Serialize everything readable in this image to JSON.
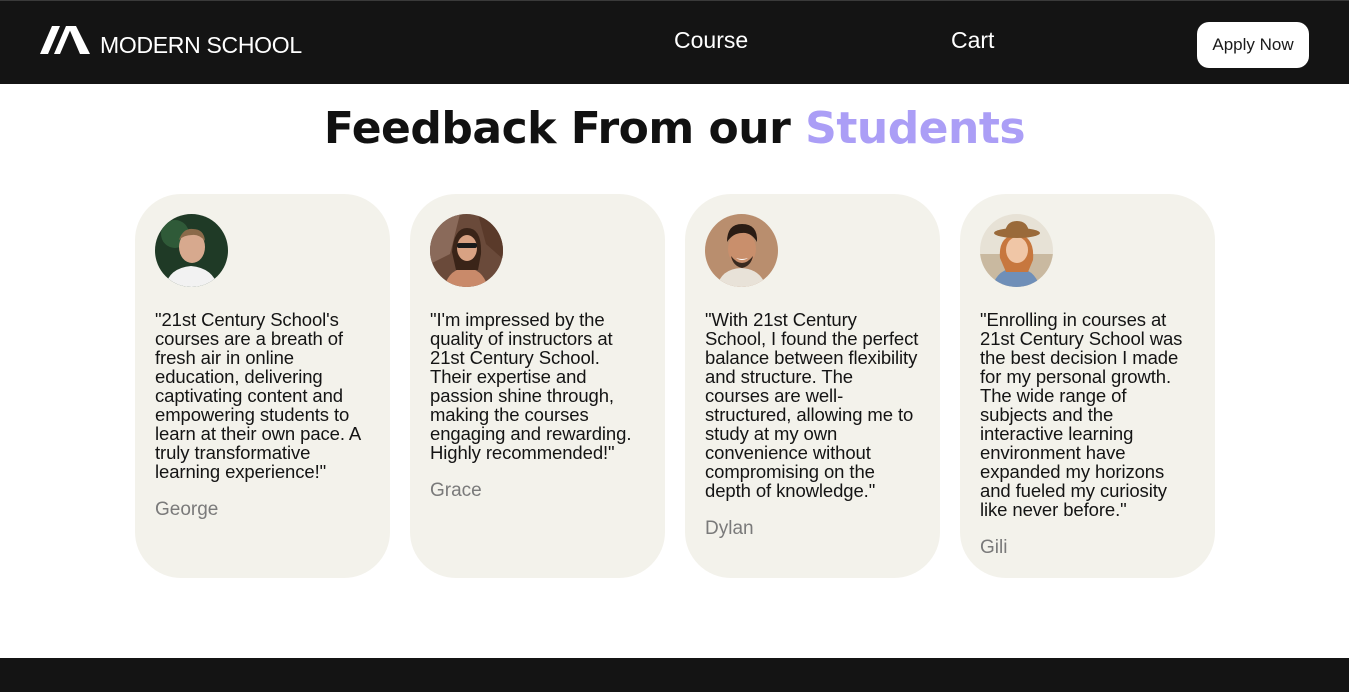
{
  "header": {
    "brand": "MODERN SCHOOL",
    "nav": [
      {
        "label": "Course"
      },
      {
        "label": "Cart"
      }
    ],
    "cta_label": "Apply Now"
  },
  "section": {
    "title_main": "Feedback From our",
    "title_accent": "Students",
    "accent_color": "#ab9ef6"
  },
  "testimonials": [
    {
      "quote": "\"21st Century School's courses are a breath of fresh air in online education, delivering captivating content and empowering students to learn at their own pace. A truly transformative learning experience!\"",
      "author": "George",
      "avatar": "avatar-george"
    },
    {
      "quote": "\"I'm impressed by the quality of instructors at 21st Century School. Their expertise and passion shine through, making the courses engaging and rewarding. Highly recommended!\"",
      "author": "Grace",
      "avatar": "avatar-grace"
    },
    {
      "quote": "\"With 21st Century School, I found the perfect balance between flexibility and structure. The courses are well-structured, allowing me to study at my own convenience without compromising on the depth of knowledge.\"",
      "author": "Dylan",
      "avatar": "avatar-dylan"
    },
    {
      "quote": "\"Enrolling in courses at 21st Century School was the best decision I made for my personal growth. The wide range of subjects and the interactive learning environment have expanded my horizons and fueled my curiosity like never before.\"",
      "author": "Gili",
      "avatar": "avatar-gili"
    }
  ],
  "colors": {
    "header_bg": "#141414",
    "card_bg": "#f3f2eb",
    "author_text": "#7a7a7a"
  }
}
